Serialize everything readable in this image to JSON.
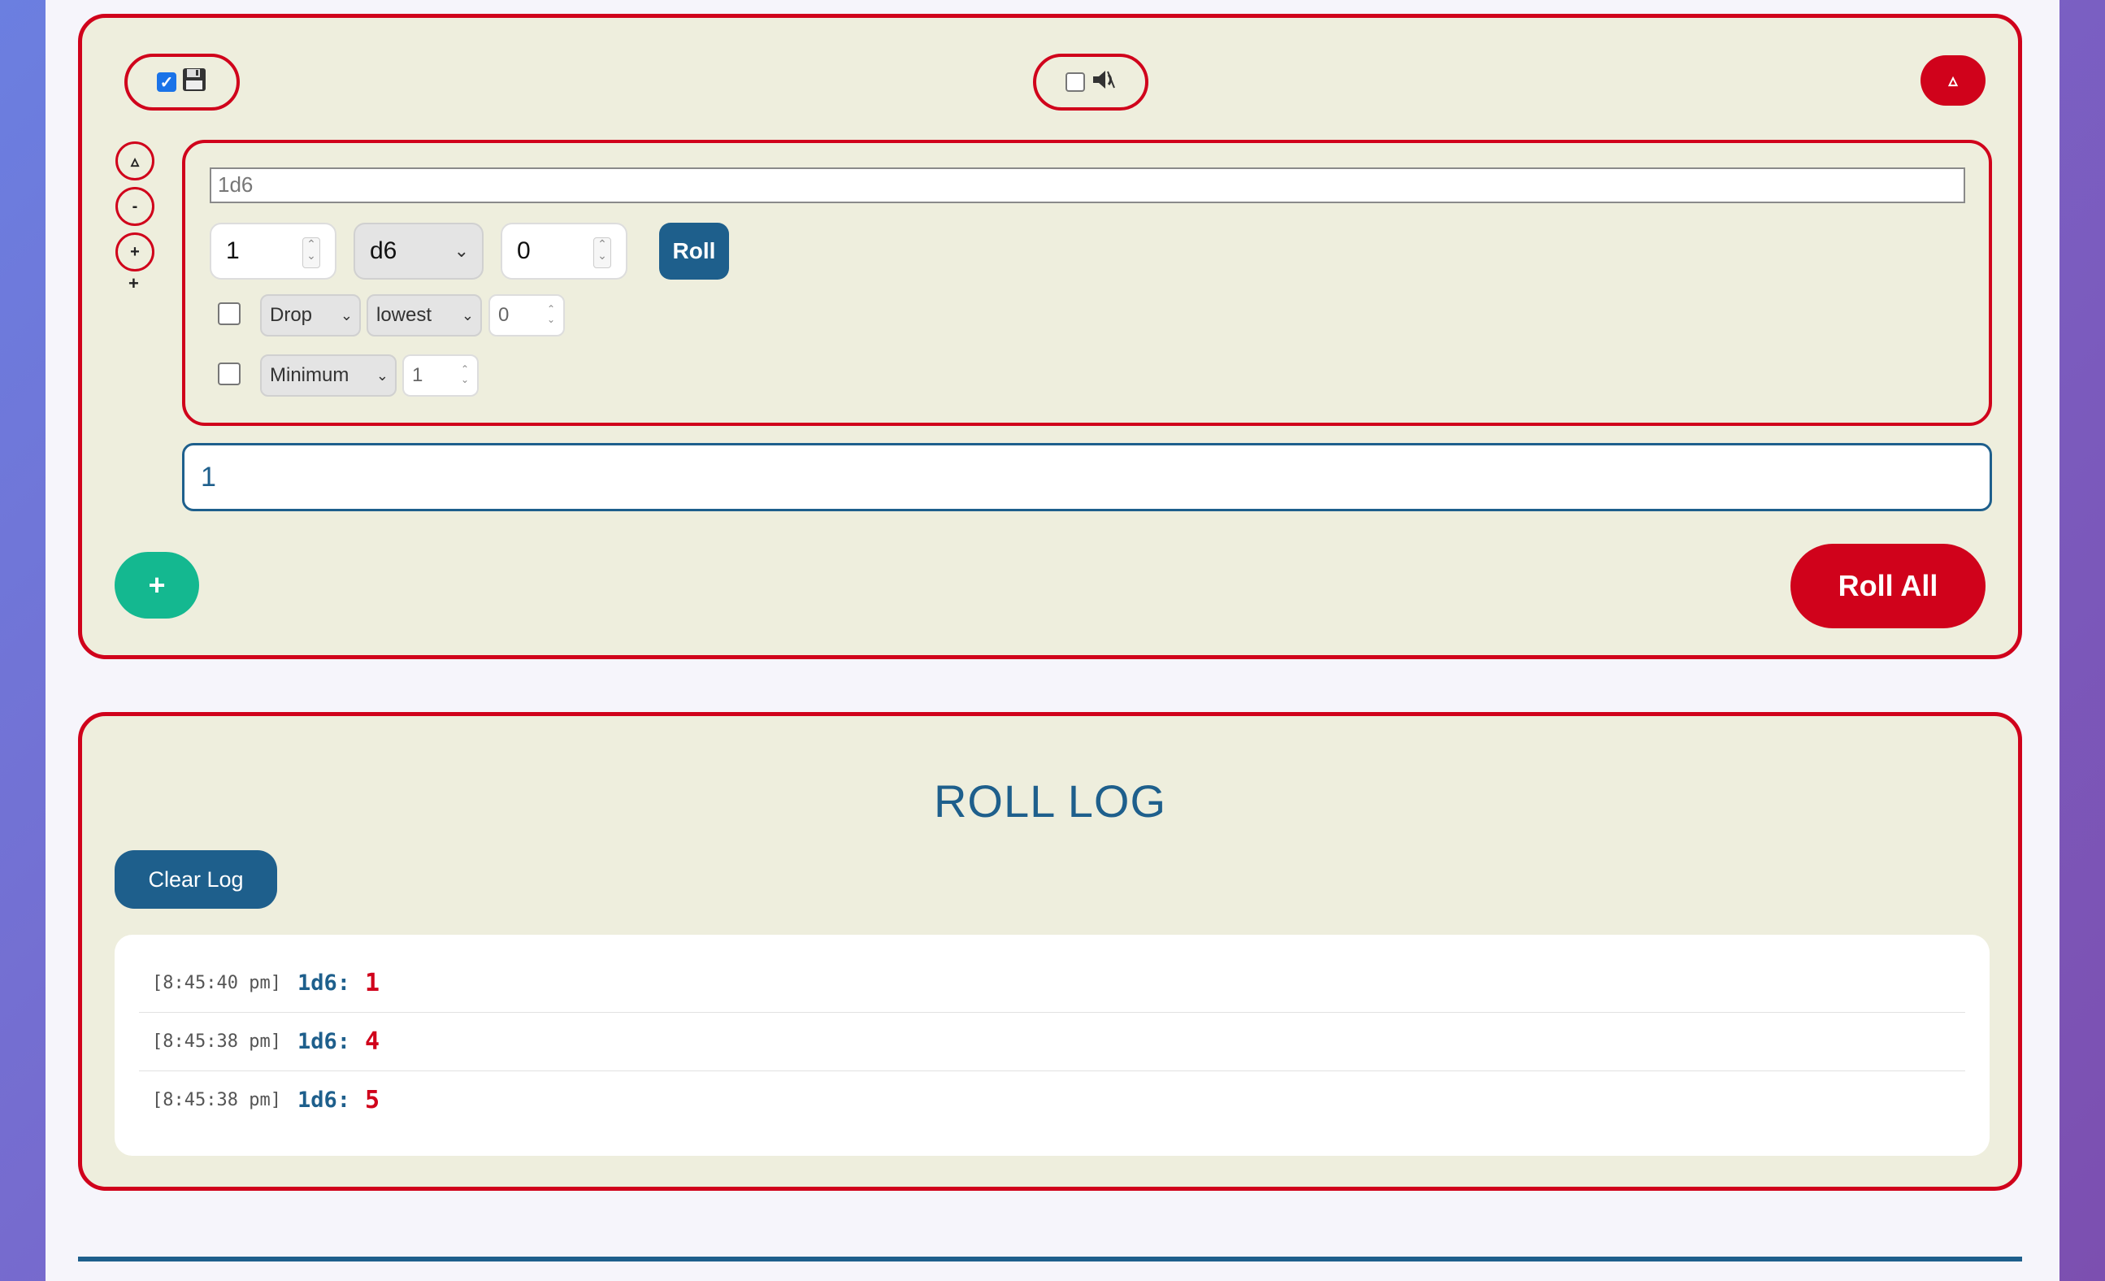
{
  "settings": {
    "save_enabled": true,
    "save_icon": "floppy-disk-icon",
    "sound_enabled": false,
    "sound_icon": "speaker-icon",
    "collapse_label": "▵"
  },
  "side_controls": {
    "collapse": "▵",
    "remove": "-",
    "add": "+",
    "add_extra": "+"
  },
  "dice_group": {
    "expression_placeholder": "1d6",
    "count": "1",
    "die": "d6",
    "modifier": "0",
    "roll_label": "Roll",
    "drop": {
      "enabled": false,
      "mode": "Drop",
      "which": "lowest",
      "amount": "0"
    },
    "minimum": {
      "enabled": false,
      "mode": "Minimum",
      "value": "1"
    },
    "result": "1"
  },
  "actions": {
    "add_group": "+",
    "roll_all": "Roll All"
  },
  "log": {
    "title": "ROLL LOG",
    "clear_label": "Clear Log",
    "entries": [
      {
        "time": "[8:45:40 pm]",
        "expr": "1d6:",
        "value": "1"
      },
      {
        "time": "[8:45:38 pm]",
        "expr": "1d6:",
        "value": "4"
      },
      {
        "time": "[8:45:38 pm]",
        "expr": "1d6:",
        "value": "5"
      }
    ]
  },
  "colors": {
    "accent_red": "#d0021b",
    "accent_blue": "#1e5f8c",
    "accent_green": "#14b890",
    "panel_bg": "#eeeedd"
  }
}
